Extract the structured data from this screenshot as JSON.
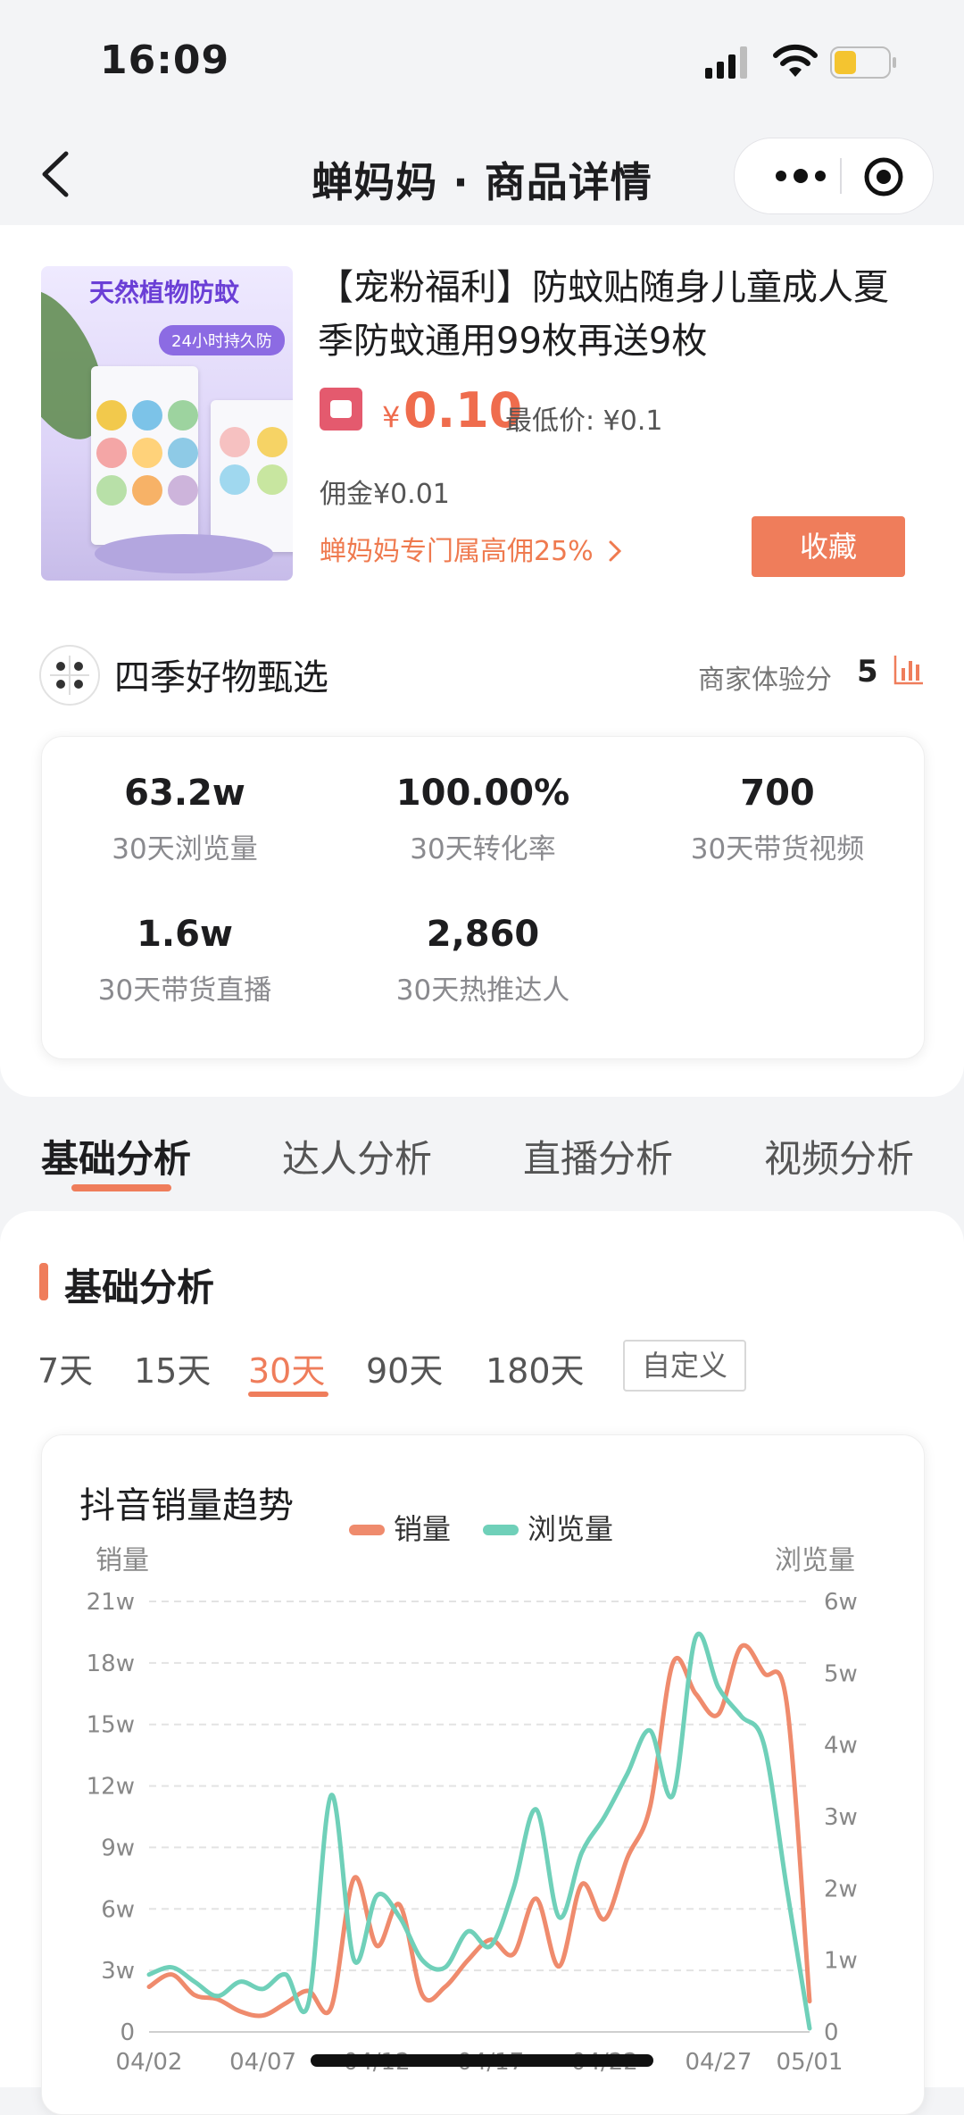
{
  "status_bar": {
    "time": "16:09"
  },
  "nav": {
    "title": "蝉妈妈 · 商品详情"
  },
  "product": {
    "image_title": "天然植物防蚊",
    "image_subtitle": "24小时持久防",
    "title": "【宠粉福利】防蚊贴随身儿童成人夏季防蚊通用99枚再送9枚",
    "price_symbol": "¥",
    "price": "0.10",
    "lowest_price": "最低价: ¥0.1",
    "commission": "佣金¥0.01",
    "promo": "蝉妈妈专门属高佣25%",
    "collect_label": "收藏"
  },
  "shop": {
    "name": "四季好物甄选",
    "score_label": "商家体验分",
    "score": "5"
  },
  "stats": [
    {
      "value": "63.2w",
      "label": "30天浏览量"
    },
    {
      "value": "100.00%",
      "label": "30天转化率"
    },
    {
      "value": "700",
      "label": "30天带货视频"
    },
    {
      "value": "1.6w",
      "label": "30天带货直播"
    },
    {
      "value": "2,860",
      "label": "30天热推达人"
    }
  ],
  "tabs": [
    "基础分析",
    "达人分析",
    "直播分析",
    "视频分析"
  ],
  "section": {
    "title": "基础分析",
    "ranges": [
      "7天",
      "15天",
      "30天",
      "90天",
      "180天"
    ],
    "active_range": "30天",
    "custom_label": "自定义"
  },
  "colors": {
    "accent": "#ef7d5b",
    "sales": "#ef8b6d",
    "views": "#6fd0b9"
  },
  "chart_data": {
    "type": "line",
    "title": "抖音销量趋势",
    "ylabel_left": "销量",
    "ylabel_right": "浏览量",
    "legend_position": "top-center",
    "grid": true,
    "x": [
      "04/02",
      "04/03",
      "04/04",
      "04/05",
      "04/06",
      "04/07",
      "04/08",
      "04/09",
      "04/10",
      "04/11",
      "04/12",
      "04/13",
      "04/14",
      "04/15",
      "04/16",
      "04/17",
      "04/18",
      "04/19",
      "04/20",
      "04/21",
      "04/22",
      "04/23",
      "04/24",
      "04/25",
      "04/26",
      "04/27",
      "04/28",
      "04/29",
      "04/30",
      "05/01"
    ],
    "x_tick_labels": [
      "04/02",
      "04/07",
      "04/12",
      "04/17",
      "04/22",
      "04/27",
      "05/01"
    ],
    "y_left_ticks": [
      "0",
      "3w",
      "6w",
      "9w",
      "12w",
      "15w",
      "18w",
      "21w"
    ],
    "y_right_ticks": [
      "0",
      "1w",
      "2w",
      "3w",
      "4w",
      "5w",
      "6w"
    ],
    "ylim_left": [
      0,
      210000
    ],
    "ylim_right": [
      0,
      60000
    ],
    "series": [
      {
        "name": "销量",
        "axis": "left",
        "values": [
          22000,
          28000,
          18000,
          16000,
          10000,
          8000,
          14000,
          20000,
          12000,
          75000,
          42000,
          62000,
          18000,
          22000,
          35000,
          45000,
          38000,
          65000,
          32000,
          72000,
          55000,
          85000,
          110000,
          180000,
          165000,
          155000,
          188000,
          175000,
          160000,
          15000
        ]
      },
      {
        "name": "浏览量",
        "axis": "right",
        "values": [
          8000,
          9000,
          7000,
          5000,
          7000,
          6000,
          8000,
          4000,
          33000,
          10000,
          19000,
          16000,
          10000,
          9000,
          14000,
          12000,
          20000,
          31000,
          16000,
          25000,
          30000,
          36000,
          42000,
          33000,
          55000,
          48000,
          44000,
          40000,
          20000,
          500
        ]
      }
    ]
  }
}
